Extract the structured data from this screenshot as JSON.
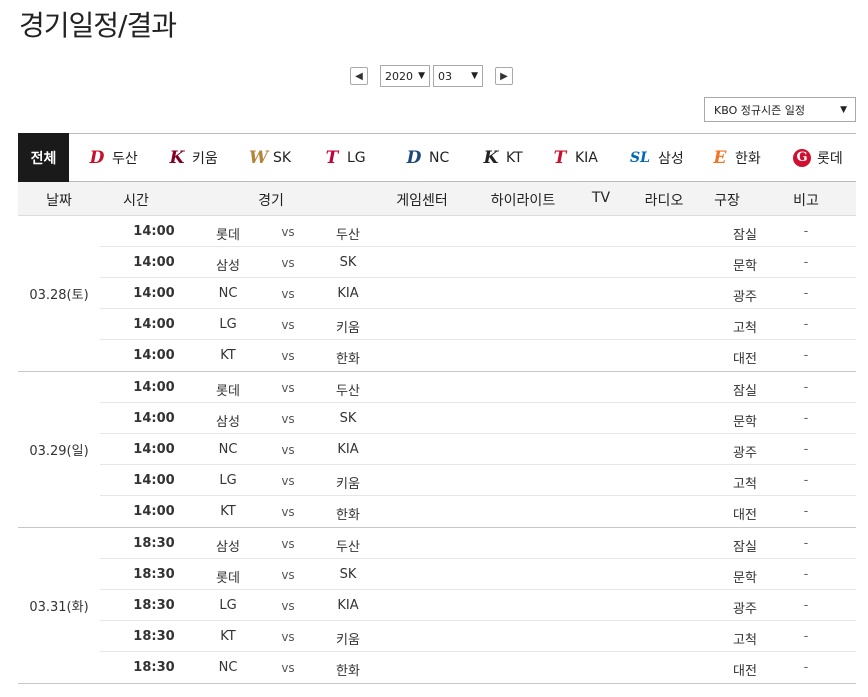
{
  "page_title": "경기일정/결과",
  "month_nav": {
    "prev_label": "◀",
    "next_label": "▶",
    "year": "2020",
    "month": "03"
  },
  "season_select": "KBO 정규시즌 일정",
  "teams": {
    "all": "전체",
    "items": [
      {
        "logo": "D",
        "name": "두산",
        "color": "#c8102e"
      },
      {
        "logo": "K",
        "name": "키움",
        "color": "#820024"
      },
      {
        "logo": "W",
        "name": "SK",
        "color": "#b5843b"
      },
      {
        "logo": "T",
        "name": "LG",
        "color": "#c30037"
      },
      {
        "logo": "D",
        "name": "NC",
        "color": "#1d467c"
      },
      {
        "logo": "K",
        "name": "KT",
        "color": "#222222"
      },
      {
        "logo": "T",
        "name": "KIA",
        "color": "#c8102e"
      },
      {
        "logo": "SL",
        "name": "삼성",
        "color": "#0066b3"
      },
      {
        "logo": "E",
        "name": "한화",
        "color": "#f37321"
      },
      {
        "logo": "G",
        "name": "롯데",
        "color": "#d00f31"
      }
    ]
  },
  "headers": {
    "date": "날짜",
    "time": "시간",
    "game": "경기",
    "gamecenter": "게임센터",
    "highlight": "하이라이트",
    "tv": "TV",
    "radio": "라디오",
    "stadium": "구장",
    "note": "비고"
  },
  "days": [
    {
      "date": "03.28(토)",
      "games": [
        {
          "time": "14:00",
          "away": "롯데",
          "vs": "vs",
          "home": "두산",
          "stadium": "잠실",
          "note": "-"
        },
        {
          "time": "14:00",
          "away": "삼성",
          "vs": "vs",
          "home": "SK",
          "stadium": "문학",
          "note": "-"
        },
        {
          "time": "14:00",
          "away": "NC",
          "vs": "vs",
          "home": "KIA",
          "stadium": "광주",
          "note": "-"
        },
        {
          "time": "14:00",
          "away": "LG",
          "vs": "vs",
          "home": "키움",
          "stadium": "고척",
          "note": "-"
        },
        {
          "time": "14:00",
          "away": "KT",
          "vs": "vs",
          "home": "한화",
          "stadium": "대전",
          "note": "-"
        }
      ]
    },
    {
      "date": "03.29(일)",
      "games": [
        {
          "time": "14:00",
          "away": "롯데",
          "vs": "vs",
          "home": "두산",
          "stadium": "잠실",
          "note": "-"
        },
        {
          "time": "14:00",
          "away": "삼성",
          "vs": "vs",
          "home": "SK",
          "stadium": "문학",
          "note": "-"
        },
        {
          "time": "14:00",
          "away": "NC",
          "vs": "vs",
          "home": "KIA",
          "stadium": "광주",
          "note": "-"
        },
        {
          "time": "14:00",
          "away": "LG",
          "vs": "vs",
          "home": "키움",
          "stadium": "고척",
          "note": "-"
        },
        {
          "time": "14:00",
          "away": "KT",
          "vs": "vs",
          "home": "한화",
          "stadium": "대전",
          "note": "-"
        }
      ]
    },
    {
      "date": "03.31(화)",
      "games": [
        {
          "time": "18:30",
          "away": "삼성",
          "vs": "vs",
          "home": "두산",
          "stadium": "잠실",
          "note": "-"
        },
        {
          "time": "18:30",
          "away": "롯데",
          "vs": "vs",
          "home": "SK",
          "stadium": "문학",
          "note": "-"
        },
        {
          "time": "18:30",
          "away": "LG",
          "vs": "vs",
          "home": "KIA",
          "stadium": "광주",
          "note": "-"
        },
        {
          "time": "18:30",
          "away": "KT",
          "vs": "vs",
          "home": "키움",
          "stadium": "고척",
          "note": "-"
        },
        {
          "time": "18:30",
          "away": "NC",
          "vs": "vs",
          "home": "한화",
          "stadium": "대전",
          "note": "-"
        }
      ]
    }
  ]
}
